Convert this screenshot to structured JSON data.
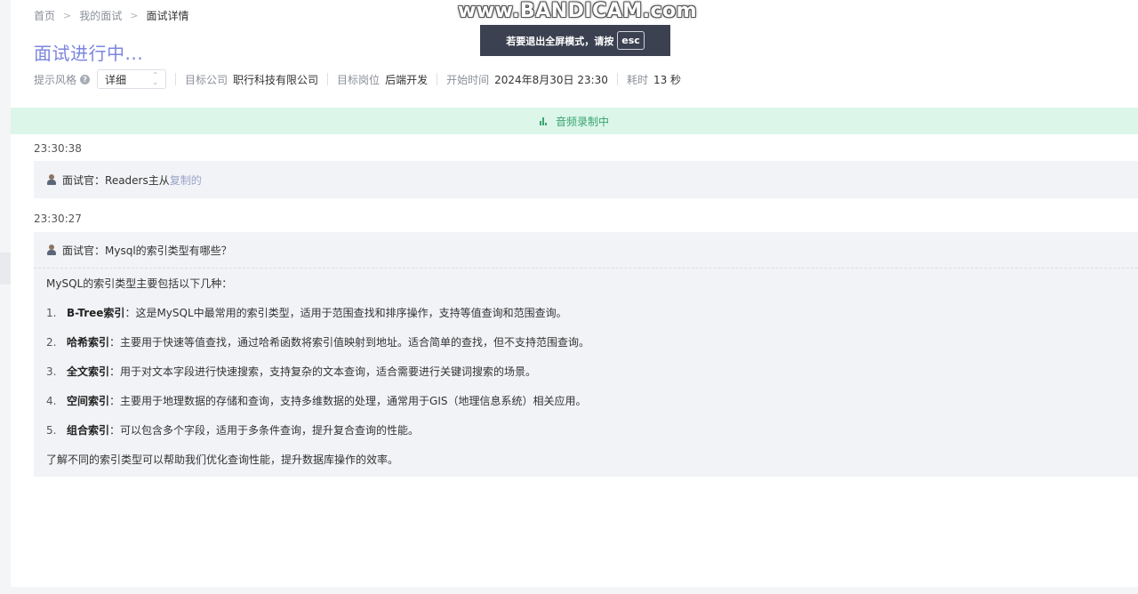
{
  "breadcrumb": {
    "home": "首页",
    "my_interviews": "我的面试",
    "current": "面试详情",
    "separator": ">"
  },
  "page_title": "面试进行中...",
  "meta": {
    "hint_style_label": "提示风格",
    "hint_style_value": "详细",
    "company_label": "目标公司",
    "company_value": "职行科技有限公司",
    "position_label": "目标岗位",
    "position_value": "后端开发",
    "start_label": "开始时间",
    "start_value": "2024年8月30日 23:30",
    "elapsed_label": "耗时",
    "elapsed_value": "13 秒"
  },
  "recording_banner": "音频录制中",
  "records": [
    {
      "time": "23:30:38",
      "interviewer_prefix": "面试官：",
      "question": "Readers主从",
      "question_tail": "复制的"
    },
    {
      "time": "23:30:27",
      "interviewer_prefix": "面试官：",
      "question": "Mysql的索引类型有哪些？"
    }
  ],
  "answer": {
    "intro": "MySQL的索引类型主要包括以下几种：",
    "items": [
      {
        "num": "1.",
        "term": "B-Tree索引",
        "desc": "：这是MySQL中最常用的索引类型，适用于范围查找和排序操作，支持等值查询和范围查询。"
      },
      {
        "num": "2.",
        "term": "哈希索引",
        "desc": "：主要用于快速等值查找，通过哈希函数将索引值映射到地址。适合简单的查找，但不支持范围查询。"
      },
      {
        "num": "3.",
        "term": "全文索引",
        "desc": "：用于对文本字段进行快速搜索，支持复杂的文本查询，适合需要进行关键词搜索的场景。"
      },
      {
        "num": "4.",
        "term": "空间索引",
        "desc": "：主要用于地理数据的存储和查询，支持多维数据的处理，通常用于GIS（地理信息系统）相关应用。"
      },
      {
        "num": "5.",
        "term": "组合索引",
        "desc": "：可以包含多个字段，适用于多条件查询，提升复合查询的性能。"
      }
    ],
    "outro": "了解不同的索引类型可以帮助我们优化查询性能，提升数据库操作的效率。"
  },
  "overlay": {
    "watermark": "www.BANDICAM.com",
    "toast_text": "若要退出全屏模式，请按",
    "toast_key": "esc"
  }
}
